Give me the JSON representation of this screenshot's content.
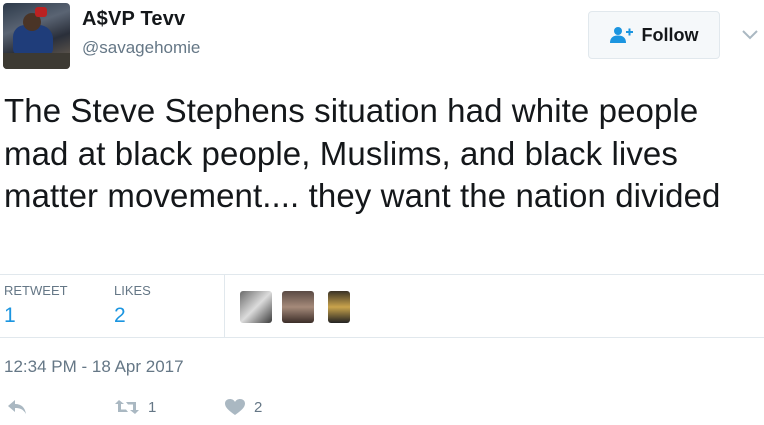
{
  "user": {
    "display_name": "A$VP Tevv",
    "screen_name": "@savagehomie"
  },
  "follow_button": {
    "label": "Follow",
    "icon": "add-user-icon"
  },
  "tweet": {
    "text": "The Steve Stephens situation had white people mad at black people, Muslims, and black lives matter movement.... they want the nation divided",
    "timestamp": "12:34 PM - 18 Apr 2017"
  },
  "stats": {
    "retweet_label": "RETWEET",
    "retweet_count": "1",
    "likes_label": "LIKES",
    "likes_count": "2"
  },
  "actions": {
    "reply_icon": "reply-icon",
    "retweet_icon": "retweet-icon",
    "retweet_count": "1",
    "like_icon": "heart-icon",
    "like_count": "2"
  },
  "colors": {
    "link_blue": "#1b95e0",
    "muted_gray": "#657786",
    "text": "#14171a",
    "border": "#e1e8ed"
  }
}
